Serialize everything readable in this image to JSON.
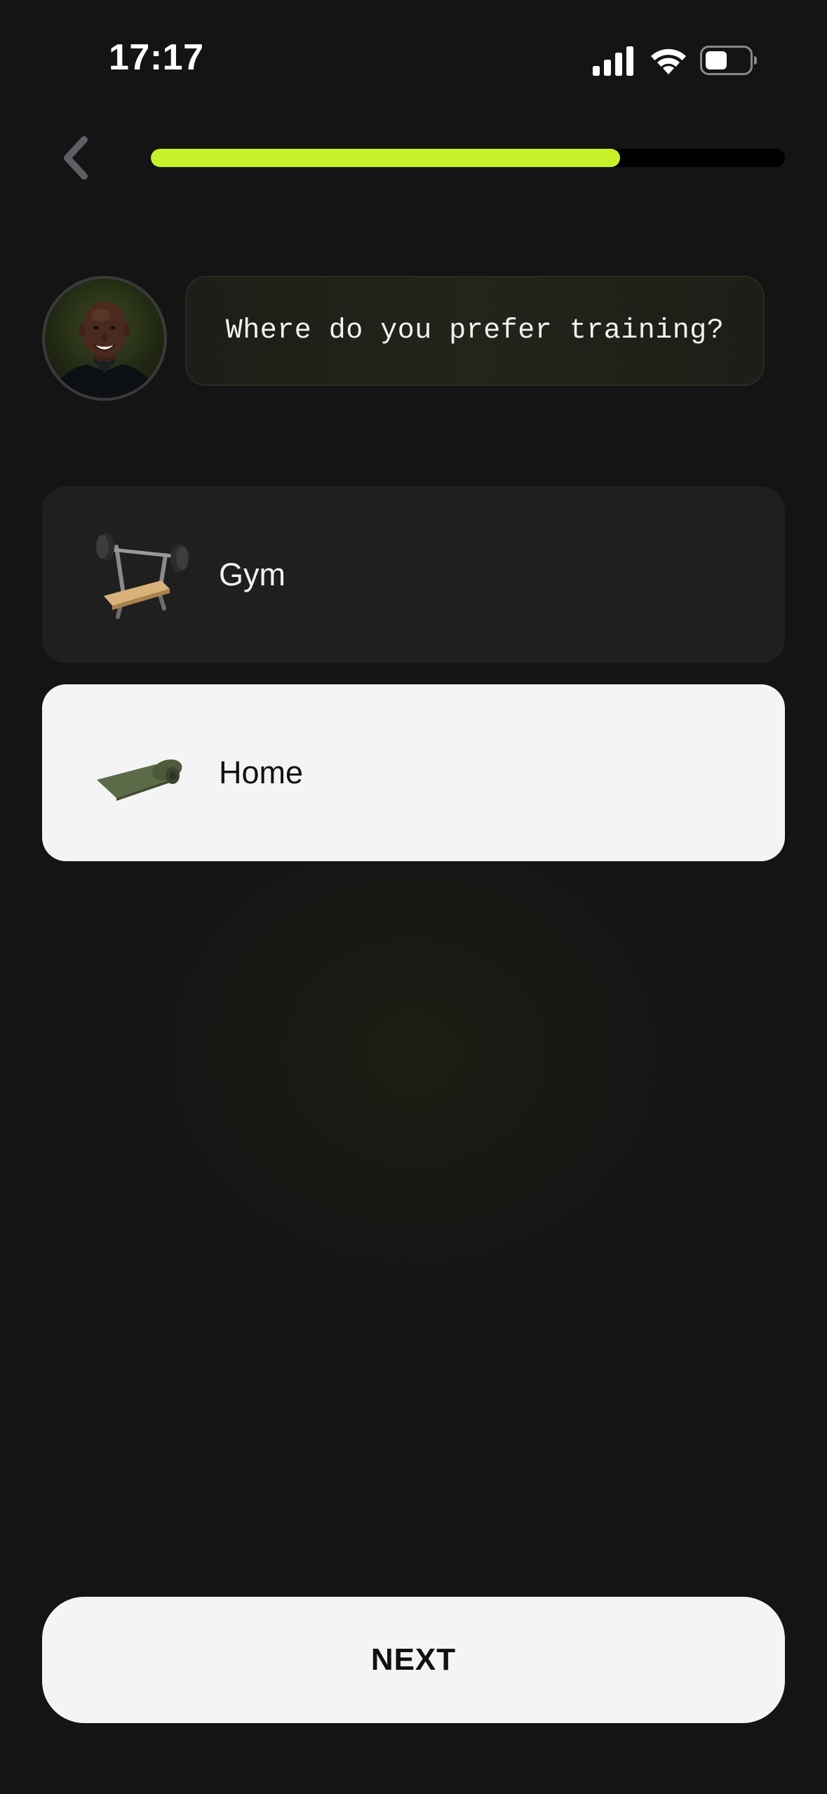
{
  "status_bar": {
    "time": "17:17",
    "icons": [
      "cellular-signal-icon",
      "wifi-icon",
      "battery-icon"
    ]
  },
  "header": {
    "back_icon": "chevron-left-icon",
    "progress_fraction": 0.74
  },
  "coach": {
    "avatar_icon": "coach-avatar",
    "question": "Where do you prefer training?"
  },
  "options": [
    {
      "label": "Gym",
      "icon": "bench-press-icon",
      "selected": false
    },
    {
      "label": "Home",
      "icon": "yoga-mat-icon",
      "selected": true
    }
  ],
  "footer": {
    "next_label": "NEXT"
  },
  "colors": {
    "background": "#141414",
    "accent": "#c7f22a",
    "card_unselected": "#1f1f1f",
    "card_selected": "#f4f4f4"
  }
}
